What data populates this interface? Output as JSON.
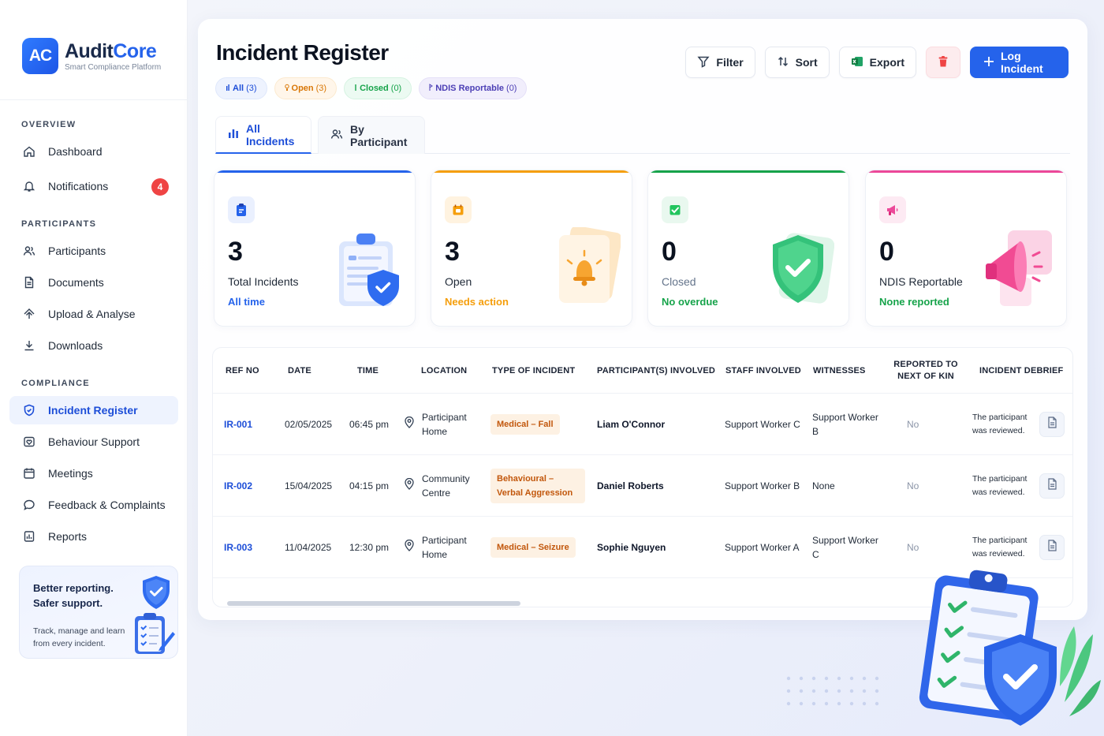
{
  "brand": {
    "logo": "AC",
    "name_a": "Audit",
    "name_b": "Core",
    "tagline": "Smart Compliance Platform"
  },
  "sidebar": {
    "sections": {
      "overview": "OVERVIEW",
      "participants": "PARTICIPANTS",
      "compliance": "COMPLIANCE"
    },
    "items": [
      {
        "label": "Dashboard",
        "icon": "home-icon"
      },
      {
        "label": "Notifications",
        "icon": "bell-icon",
        "badge": "4"
      },
      {
        "label": "Participants",
        "icon": "users-icon"
      },
      {
        "label": "Documents",
        "icon": "document-icon"
      },
      {
        "label": "Upload & Analyse",
        "icon": "upload-icon"
      },
      {
        "label": "Downloads",
        "icon": "download-icon"
      },
      {
        "label": "Incident Register",
        "icon": "shield-icon",
        "active": true
      },
      {
        "label": "Behaviour Support",
        "icon": "heart-icon"
      },
      {
        "label": "Meetings",
        "icon": "calendar-icon"
      },
      {
        "label": "Feedback & Complaints",
        "icon": "chat-icon"
      },
      {
        "label": "Reports",
        "icon": "report-icon"
      }
    ],
    "promo": {
      "title": "Better reporting. Safer support.",
      "text": "Track, manage and learn from every incident."
    }
  },
  "header": {
    "title": "Incident Register",
    "chips": [
      {
        "label": "All",
        "count": "(3)"
      },
      {
        "label": "Open",
        "count": "(3)"
      },
      {
        "label": "Closed",
        "count": "(0)"
      },
      {
        "label": "NDIS Reportable",
        "count": "(0)"
      }
    ],
    "toolbar": {
      "filter": "Filter",
      "sort": "Sort",
      "export": "Export",
      "log": "Log Incident"
    }
  },
  "tabs": {
    "all": "All Incidents",
    "participant": "By Participant"
  },
  "stats": [
    {
      "value": "3",
      "label": "Total Incidents",
      "sub": "All time",
      "color": "#2563eb"
    },
    {
      "value": "3",
      "label": "Open",
      "sub": "Needs action",
      "color": "#f59e0b"
    },
    {
      "value": "0",
      "label": "Closed",
      "sub": "No overdue",
      "color": "#16a34a"
    },
    {
      "value": "0",
      "label": "NDIS Reportable",
      "sub": "None reported",
      "color": "#ec4899"
    }
  ],
  "table": {
    "headers": {
      "ref": "REF NO",
      "date": "DATE",
      "time": "TIME",
      "location": "LOCATION",
      "type": "TYPE OF INCIDENT",
      "participants": "PARTICIPANT(S) INVOLVED",
      "staff": "STAFF INVOLVED",
      "witnesses": "WITNESSES",
      "reported": "REPORTED TO NEXT OF KIN",
      "debrief": "INCIDENT DEBRIEF"
    },
    "rows": [
      {
        "ref": "IR-001",
        "date": "02/05/2025",
        "time": "06:45 pm",
        "location": "Participant Home",
        "type": "Medical – Fall",
        "participant": "Liam O'Connor",
        "staff": "Support Worker C",
        "witnesses": "Support Worker B",
        "reported": "No",
        "debrief": "The participant was reviewed."
      },
      {
        "ref": "IR-002",
        "date": "15/04/2025",
        "time": "04:15 pm",
        "location": "Community Centre",
        "type": "Behavioural – Verbal Aggression",
        "participant": "Daniel Roberts",
        "staff": "Support Worker B",
        "witnesses": "None",
        "reported": "No",
        "debrief": "The participant was reviewed."
      },
      {
        "ref": "IR-003",
        "date": "11/04/2025",
        "time": "12:30 pm",
        "location": "Participant Home",
        "type": "Medical – Seizure",
        "participant": "Sophie Nguyen",
        "staff": "Support Worker A",
        "witnesses": "Support Worker C",
        "reported": "No",
        "debrief": "The participant was reviewed."
      }
    ]
  },
  "colors": {
    "accent": "#2563eb",
    "danger": "#ef4444"
  }
}
